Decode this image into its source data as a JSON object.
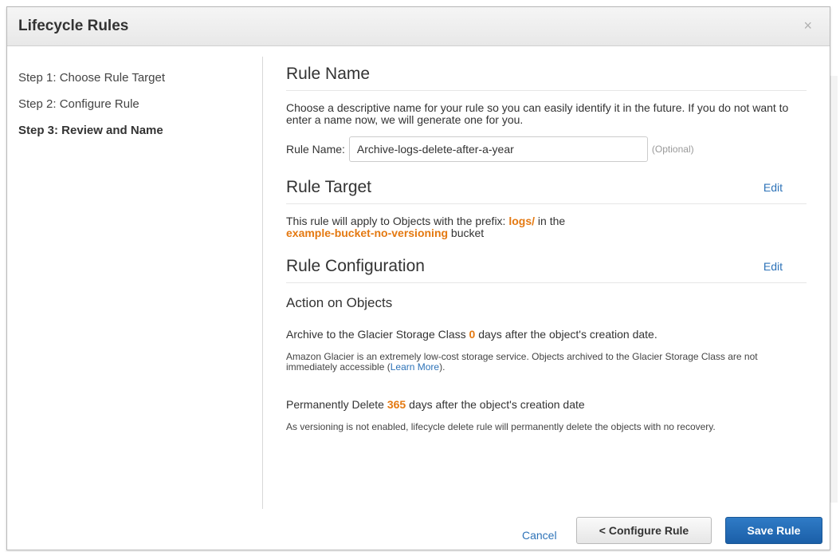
{
  "dialog": {
    "title": "Lifecycle Rules",
    "close_icon": "×"
  },
  "steps": [
    {
      "label": "Step 1: Choose Rule Target",
      "active": false
    },
    {
      "label": "Step 2: Configure Rule",
      "active": false
    },
    {
      "label": "Step 3: Review and Name",
      "active": true
    }
  ],
  "rule_name": {
    "title": "Rule Name",
    "description": "Choose a descriptive name for your rule so you can easily identify it in the future. If you do not want to enter a name now, we will generate one for you.",
    "field_label": "Rule Name:",
    "value": "Archive-logs-delete-after-a-year",
    "optional_label": "(Optional)"
  },
  "rule_target": {
    "title": "Rule Target",
    "edit_label": "Edit",
    "text_before_prefix": "This rule will apply to Objects with the prefix: ",
    "prefix": "logs/",
    "text_after_prefix": " in the",
    "bucket": "example-bucket-no-versioning",
    "text_after_bucket": " bucket"
  },
  "rule_configuration": {
    "title": "Rule Configuration",
    "edit_label": "Edit",
    "action_title": "Action on Objects",
    "archive_text_before": "Archive to the Glacier Storage Class ",
    "archive_days": "0",
    "archive_text_after": " days after the object's creation date.",
    "archive_note_before": "Amazon Glacier is an extremely low-cost storage service. Objects archived to the Glacier Storage Class are not immediately accessible (",
    "learn_more_label": "Learn More",
    "archive_note_after": ").",
    "delete_text_before": "Permanently Delete ",
    "delete_days": "365",
    "delete_text_after": " days after the object's creation date",
    "delete_note": "As versioning is not enabled, lifecycle delete rule will permanently delete the objects with no recovery."
  },
  "footer": {
    "cancel_label": "Cancel",
    "back_label": "< Configure Rule",
    "save_label": "Save Rule"
  },
  "colors": {
    "highlight": "#e47911",
    "link": "#2e73b8",
    "primary_button": "#1b5fa8"
  }
}
